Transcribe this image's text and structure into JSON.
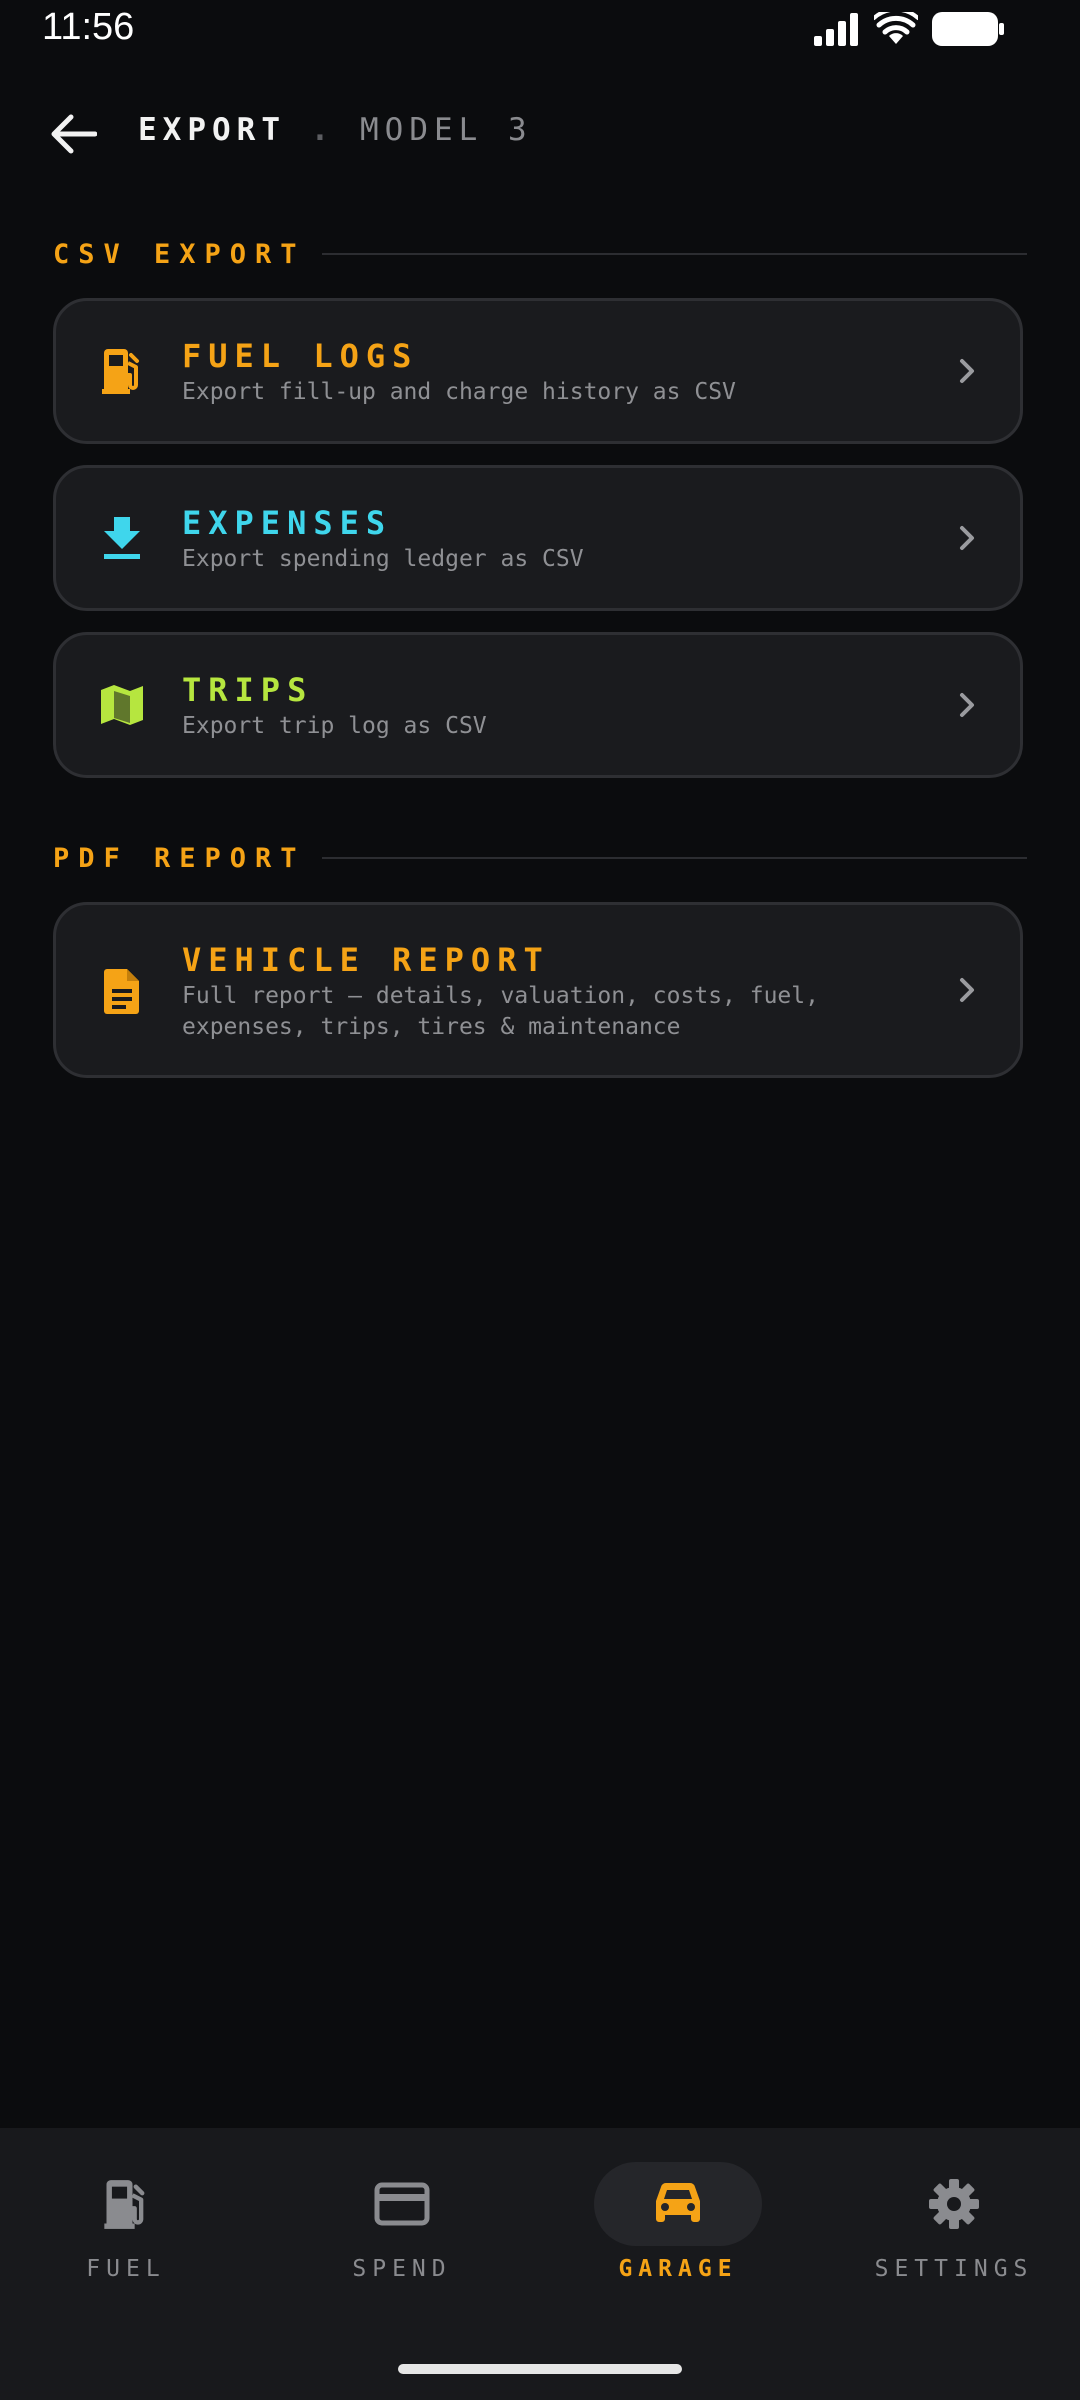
{
  "status_bar": {
    "time": "11:56"
  },
  "header": {
    "title": "EXPORT",
    "separator": ".",
    "subtitle": "MODEL 3"
  },
  "colors": {
    "accent": "#f5a316",
    "cyan": "#3fd6ec",
    "lime": "#b6e63f",
    "background": "#0b0c0e",
    "card": "#1a1b1e"
  },
  "sections": [
    {
      "label": "CSV EXPORT",
      "items": [
        {
          "title": "FUEL LOGS",
          "description": "Export fill-up and charge history as CSV",
          "icon": "fuel-pump-icon",
          "color": "#f5a316"
        },
        {
          "title": "EXPENSES",
          "description": "Export spending ledger as CSV",
          "icon": "download-icon",
          "color": "#3fd6ec"
        },
        {
          "title": "TRIPS",
          "description": "Export trip log as CSV",
          "icon": "map-icon",
          "color": "#b6e63f"
        }
      ]
    },
    {
      "label": "PDF REPORT",
      "items": [
        {
          "title": "VEHICLE REPORT",
          "description": "Full report — details, valuation, costs, fuel, expenses, trips, tires & maintenance",
          "icon": "document-icon",
          "color": "#f5a316"
        }
      ]
    }
  ],
  "bottom_nav": [
    {
      "label": "FUEL",
      "icon": "fuel-pump-icon",
      "active": false
    },
    {
      "label": "SPEND",
      "icon": "credit-card-icon",
      "active": false
    },
    {
      "label": "GARAGE",
      "icon": "car-icon",
      "active": true
    },
    {
      "label": "SETTINGS",
      "icon": "gear-icon",
      "active": false
    }
  ]
}
